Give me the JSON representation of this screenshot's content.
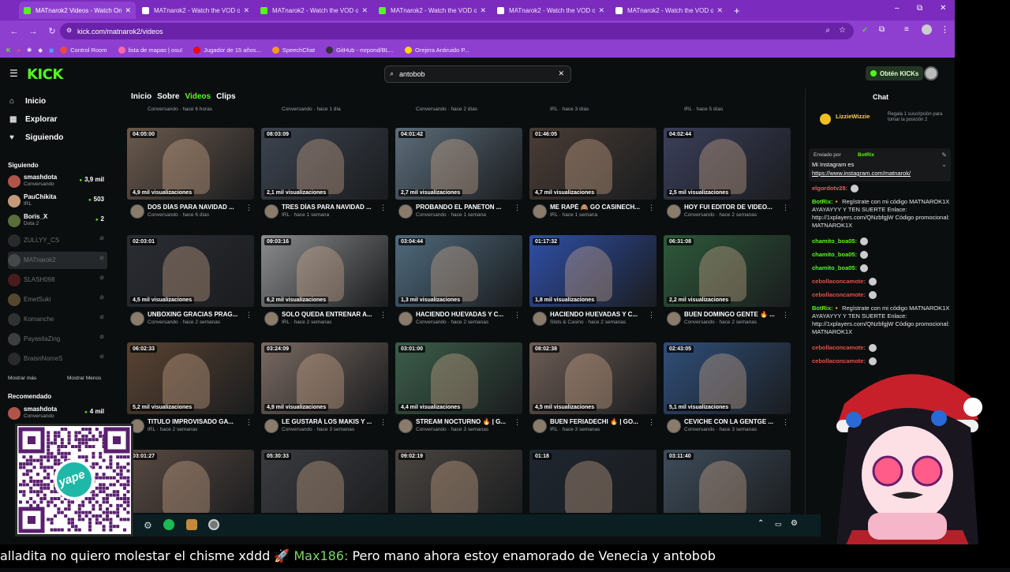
{
  "tabs": [
    {
      "title": "MATnarok2 Videos - Watch On",
      "active": true,
      "color": "#53fc18"
    },
    {
      "title": "MATnarok2 - Watch the VOD o",
      "active": false,
      "color": "#ffffff"
    },
    {
      "title": "MATnarok2 - Watch the VOD o",
      "active": false,
      "color": "#53fc18"
    },
    {
      "title": "MATnarok2 - Watch the VOD o",
      "active": false,
      "color": "#53fc18"
    },
    {
      "title": "MATnarok2 - Watch the VOD o",
      "active": false,
      "color": "#ffffff"
    },
    {
      "title": "MATnarok2 - Watch the VOD o",
      "active": false,
      "color": "#ffffff"
    }
  ],
  "new_tab": "+",
  "window_controls": {
    "minimize": "–",
    "maximize": "⧉",
    "close": "✕"
  },
  "address": {
    "url": "kick.com/matnarok2/videos"
  },
  "bookmarks": [
    {
      "label": "Control Room",
      "color": "#e94b3c"
    },
    {
      "label": "lista de mapas | osu!",
      "color": "#ff66aa"
    },
    {
      "label": "Jugador de 15 años...",
      "color": "#ff0000"
    },
    {
      "label": "SpeechChat",
      "color": "#f39c12"
    },
    {
      "label": "GitHub - mrpond/BL...",
      "color": "#333333"
    },
    {
      "label": "Orejera Antiruido P...",
      "color": "#ffd700"
    }
  ],
  "header": {
    "logo": "KICK",
    "search_value": "antobob",
    "kicks_button": "Obtén KICKs"
  },
  "nav": [
    {
      "label": "Inicio",
      "icon": "⌂"
    },
    {
      "label": "Explorar",
      "icon": "▦"
    },
    {
      "label": "Siguiendo",
      "icon": "♥"
    }
  ],
  "following_title": "Siguiendo",
  "following": [
    {
      "name": "smashdota",
      "sub": "Conversando",
      "viewers": "3,9 mil",
      "live": true,
      "color": "#b0544a"
    },
    {
      "name": "PauChikita",
      "sub": "IRL",
      "viewers": "503",
      "live": true,
      "color": "#c49a7a"
    },
    {
      "name": "Boris_X",
      "sub": "Dota 2",
      "viewers": "2",
      "live": true,
      "color": "#5a6e3a"
    },
    {
      "name": "ZULLYY_CS",
      "sub": "",
      "viewers": "",
      "live": false,
      "color": "#555"
    },
    {
      "name": "MATnarok2",
      "sub": "",
      "viewers": "",
      "live": false,
      "color": "#777",
      "selected": true
    },
    {
      "name": "SLASH098",
      "sub": "",
      "viewers": "",
      "live": false,
      "color": "#a33"
    },
    {
      "name": "EmetSuki",
      "sub": "",
      "viewers": "",
      "live": false,
      "color": "#c8a060"
    },
    {
      "name": "Komanche",
      "sub": "",
      "viewers": "",
      "live": false,
      "color": "#666"
    },
    {
      "name": "PayasitaZing",
      "sub": "",
      "viewers": "",
      "live": false,
      "color": "#888"
    },
    {
      "name": "BraisnNomeS",
      "sub": "",
      "viewers": "",
      "live": false,
      "color": "#555"
    }
  ],
  "show_more": "Mostrar más",
  "show_less": "Mostrar Menos",
  "recommended_title": "Recomendado",
  "recommended": [
    {
      "name": "smashdota",
      "sub": "Conversando",
      "viewers": "4 mil",
      "live": true,
      "color": "#b0544a"
    }
  ],
  "content_tabs": [
    {
      "label": "Inicio",
      "active": false
    },
    {
      "label": "Sobre",
      "active": false
    },
    {
      "label": "Videos",
      "active": true
    },
    {
      "label": "Clips",
      "active": false
    }
  ],
  "top_row_meta": [
    "Conversando · hace 6 horas",
    "Conversando · hace 1 día",
    "Conversando · hace 2 días",
    "IRL · hace 3 días",
    "IRL · hace 5 días"
  ],
  "videos": [
    {
      "dur": "04:05:00",
      "views": "4,9 mil visualizaciones",
      "title": "DOS DÍAS PARA NAVIDAD ...",
      "meta": "Conversando · hace 6 días",
      "bg": "#6b5a4d"
    },
    {
      "dur": "08:03:09",
      "views": "2,1 mil visualizaciones",
      "title": "TRES DÍAS PARA NAVIDAD ...",
      "meta": "IRL · hace 1 semana",
      "bg": "#3d4450"
    },
    {
      "dur": "04:01:42",
      "views": "2,7 mil visualizaciones",
      "title": "PROBANDO EL PANETON ...",
      "meta": "Conversando · hace 1 semana",
      "bg": "#5c6d7a"
    },
    {
      "dur": "01:46:05",
      "views": "4,7 mil visualizaciones",
      "title": "ME RAPÉ 🙈 GO CASINECH...",
      "meta": "IRL · hace 1 semana",
      "bg": "#4a3d36"
    },
    {
      "dur": "04:02:44",
      "views": "2,5 mil visualizaciones",
      "title": "HOY FUI EDITOR DE VIDEO...",
      "meta": "Conversando · hace 2 semanas",
      "bg": "#3b3f5a"
    },
    {
      "dur": "02:03:01",
      "views": "4,5 mil visualizaciones",
      "title": "UNBOXING GRACIAS PRAG...",
      "meta": "Conversando · hace 2 semanas",
      "bg": "#2a2d33"
    },
    {
      "dur": "09:03:16",
      "views": "6,2 mil visualizaciones",
      "title": "SOLO QUEDA ENTRENAR A...",
      "meta": "IRL · hace 2 semanas",
      "bg": "#8a8c8e"
    },
    {
      "dur": "03:04:44",
      "views": "1,3 mil visualizaciones",
      "title": "HACIENDO HUEVADAS Y C...",
      "meta": "Conversando · hace 2 semanas",
      "bg": "#4f6a7d"
    },
    {
      "dur": "01:17:32",
      "views": "1,8 mil visualizaciones",
      "title": "HACIENDO HUEVADAS Y C...",
      "meta": "Slots & Casino · hace 2 semanas",
      "bg": "#2f4fa8"
    },
    {
      "dur": "06:31:08",
      "views": "2,2 mil visualizaciones",
      "title": "BUEN DOMINGO GENTE 🔥 ...",
      "meta": "Conversando · hace 2 semanas",
      "bg": "#2e5a3a"
    },
    {
      "dur": "06:02:33",
      "views": "5,2 mil visualizaciones",
      "title": "TITULO IMPROVISADO GA...",
      "meta": "IRL · hace 2 semanas",
      "bg": "#5a4332"
    },
    {
      "dur": "03:24:09",
      "views": "4,9 mil visualizaciones",
      "title": "LE GUSTARÁ LOS MAKIS Y ...",
      "meta": "Conversando · hace 3 semanas",
      "bg": "#7a6a62"
    },
    {
      "dur": "03:01:00",
      "views": "4,4 mil visualizaciones",
      "title": "STREAM NOCTURNO 🔥 | G...",
      "meta": "Conversando · hace 3 semanas",
      "bg": "#3c5e4a"
    },
    {
      "dur": "08:02:38",
      "views": "4,5 mil visualizaciones",
      "title": "BUEN FERIADECHI 🔥 | GO...",
      "meta": "IRL · hace 3 semanas",
      "bg": "#6d5d55"
    },
    {
      "dur": "02:43:05",
      "views": "5,1 mil visualizaciones",
      "title": "CEVICHE CON LA GENTGE ...",
      "meta": "Conversando · hace 3 semanas",
      "bg": "#2f4f7a"
    },
    {
      "dur": "03:01:27",
      "views": "",
      "title": "",
      "meta": "",
      "bg": "#5a4a42"
    },
    {
      "dur": "05:30:33",
      "views": "",
      "title": "",
      "meta": "",
      "bg": "#3a3c40"
    },
    {
      "dur": "09:02:19",
      "views": "",
      "title": "",
      "meta": "",
      "bg": "#4a4540"
    },
    {
      "dur": "01:18",
      "views": "",
      "title": "",
      "meta": "",
      "bg": "#1e2630"
    },
    {
      "dur": "03:11:40",
      "views": "",
      "title": "",
      "meta": "",
      "bg": "#3e4c5a"
    }
  ],
  "chat": {
    "title": "Chat",
    "gift_user": "LizzieWizzie",
    "gift_text": "Regala 1 suscripción para tomar la posición 2",
    "pinned_by": "Enviado por",
    "pinned_user": "BotRix",
    "pinned_msg": "Mi Instagram es",
    "pinned_link": "https://www.instagram.com/matnarok/",
    "messages": [
      {
        "user": "elgordotv28:",
        "text": "",
        "color": "#e06060"
      },
      {
        "user": "BotRix:",
        "text": "🔸 Regístrate con mi código MATNAROK1X AYAYAYYY Y TEN SUERTE Enlace: http://1xplayers.com/QNzbfgjW Código promocional: MATNAROK1X",
        "color": "#53fc18"
      },
      {
        "user": "chamito_boa05:",
        "text": "",
        "color": "#53fc18"
      },
      {
        "user": "chamito_boa05:",
        "text": "",
        "color": "#53fc18"
      },
      {
        "user": "chamito_boa05:",
        "text": "",
        "color": "#53fc18"
      },
      {
        "user": "cebollaconcamote:",
        "text": "",
        "color": "#e0524a"
      },
      {
        "user": "cebollaconcamote:",
        "text": "",
        "color": "#e0524a"
      },
      {
        "user": "BotRix:",
        "text": "🔸 Regístrate con mi código MATNAROK1X AYAYAYYY Y TEN SUERTE Enlace: http://1xplayers.com/QNzbfgjW Código promocional: MATNAROK1X",
        "color": "#53fc18"
      },
      {
        "user": "cebollaconcamote:",
        "text": "",
        "color": "#e0524a"
      },
      {
        "user": "cebollaconcamote:",
        "text": "",
        "color": "#e0524a"
      }
    ]
  },
  "ticker": {
    "prefix": "alladita no quiero molestar el chisme xddd 🚀 ",
    "name": "Max186:",
    "text": " Pero mano ahora estoy enamorado de Venecia y antobob"
  },
  "qr_label": "yape"
}
